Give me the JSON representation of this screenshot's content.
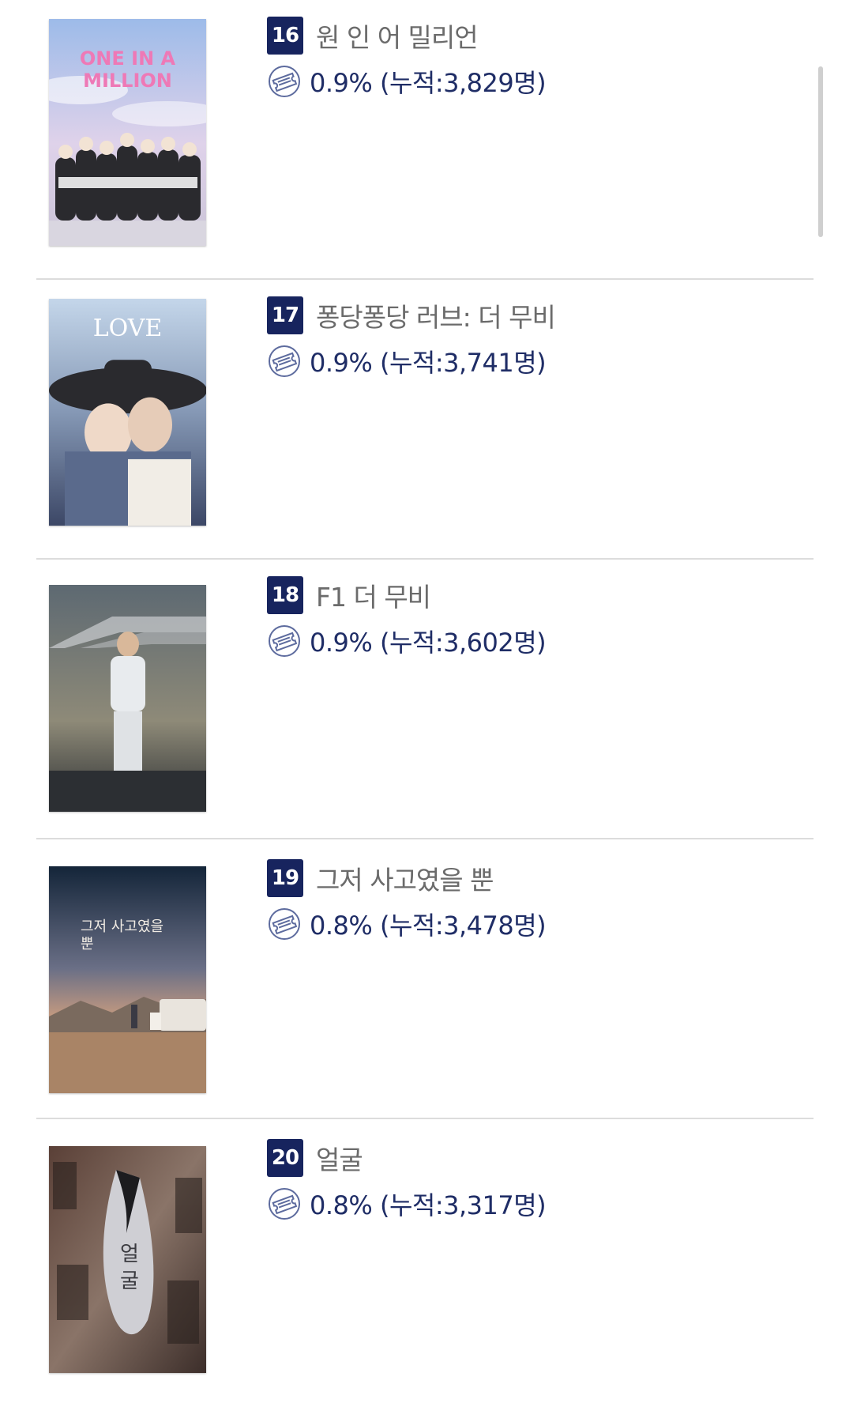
{
  "movies": [
    {
      "rank": "16",
      "title": "원 인 어 밀리언",
      "share": "0.9% (누적:3,829명)",
      "poster_text": "ONE IN A MILLION",
      "poster_colors": [
        "#a9c4ee",
        "#e9d4e6"
      ]
    },
    {
      "rank": "17",
      "title": "퐁당퐁당 러브: 더 무비",
      "share": "0.9% (누적:3,741명)",
      "poster_text": "LOVE",
      "poster_colors": [
        "#b8cde3",
        "#6f7f9c"
      ]
    },
    {
      "rank": "18",
      "title": "F1 더 무비",
      "share": "0.9% (누적:3,602명)",
      "poster_text": "",
      "poster_colors": [
        "#65707a",
        "#b59a6b"
      ]
    },
    {
      "rank": "19",
      "title": "그저 사고였을 뿐",
      "share": "0.8% (누적:3,478명)",
      "poster_text": "그저 사고였을 뿐",
      "poster_colors": [
        "#1d3047",
        "#c48f6f"
      ]
    },
    {
      "rank": "20",
      "title": "얼굴",
      "share": "0.8% (누적:3,317명)",
      "poster_text": "얼굴",
      "poster_colors": [
        "#4e3a34",
        "#7a6e66"
      ]
    }
  ],
  "icons": {
    "share": "ticket-icon"
  },
  "colors": {
    "rank_bg": "#17245e",
    "share_text": "#1f2d66",
    "title_text": "#6b6b6b"
  }
}
